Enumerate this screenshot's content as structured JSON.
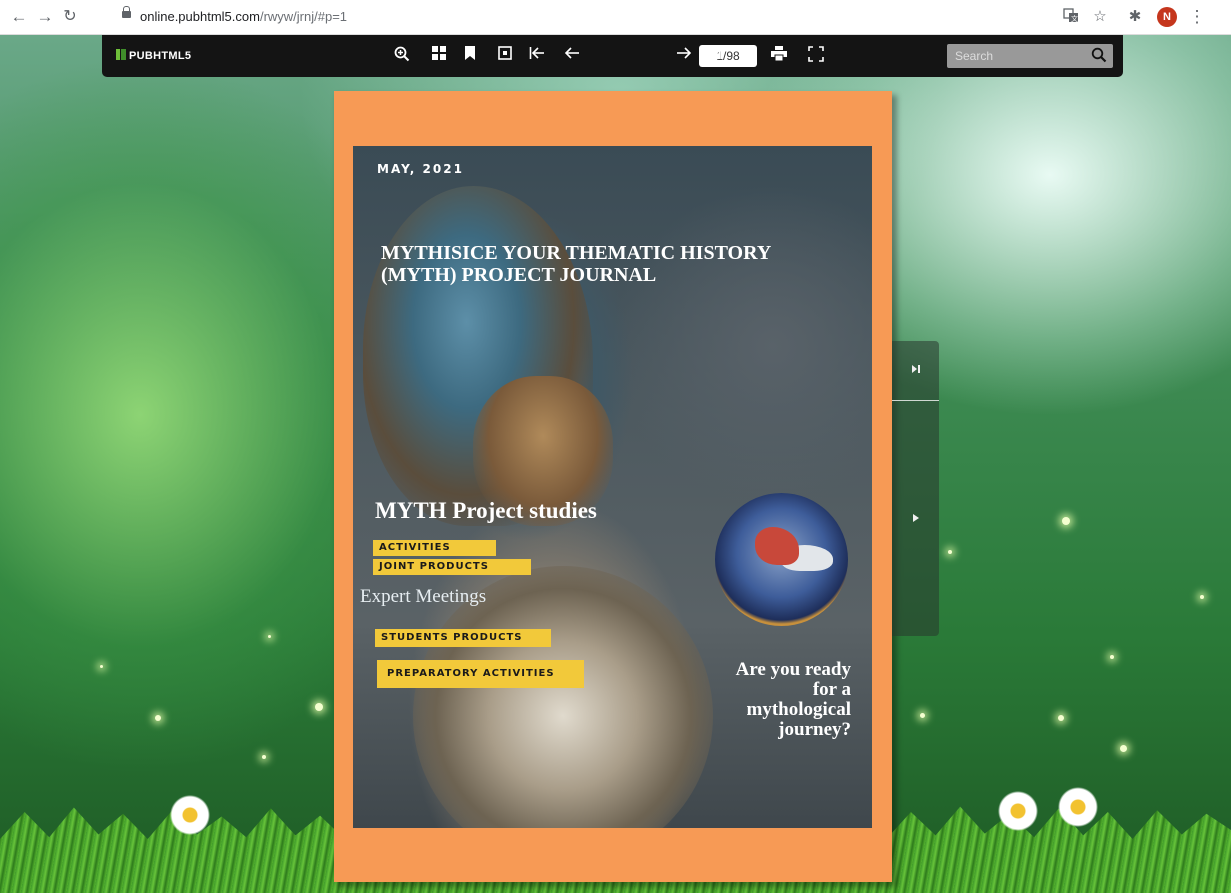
{
  "browser": {
    "url_host": "online.pubhtml5.com",
    "url_path": "/rwyw/jrnj/#p=1",
    "profile_initial": "N",
    "icons": [
      "back-arrow-icon",
      "forward-arrow-icon",
      "reload-icon",
      "lock-icon",
      "translate-icon",
      "star-icon",
      "extensions-icon",
      "menu-icon"
    ]
  },
  "toolbar": {
    "logo_text": "PUBHTML5",
    "page_indicator": "1/98",
    "search_placeholder": "Search",
    "buttons": [
      "zoom-in-icon",
      "thumbnails-icon",
      "bookmark-icon",
      "single-page-icon",
      "first-page-icon",
      "previous-page-icon",
      "next-page-icon",
      "last-page-icon",
      "share-icon",
      "print-icon",
      "fullscreen-icon"
    ]
  },
  "cover": {
    "date": "MAY, 2021",
    "title": "MYTHISICE YOUR THEMATIC HISTORY (MYTH) PROJECT JOURNAL",
    "subtitle": "MYTH Project studies",
    "tags": {
      "activities": "ACTIVITIES",
      "joint_products": "JOINT PRODUCTS",
      "students_products": "STUDENTS PRODUCTS",
      "preparatory_activities": "PREPARATORY ACTIVITIES"
    },
    "expert_meetings": "Expert Meetings",
    "cta_lines": [
      "Are you ready",
      "for a",
      "mythological",
      "journey?"
    ]
  },
  "colors": {
    "book_frame": "#f79a55",
    "toolbar": "#141414",
    "tag_yellow": "#f2c93a"
  }
}
